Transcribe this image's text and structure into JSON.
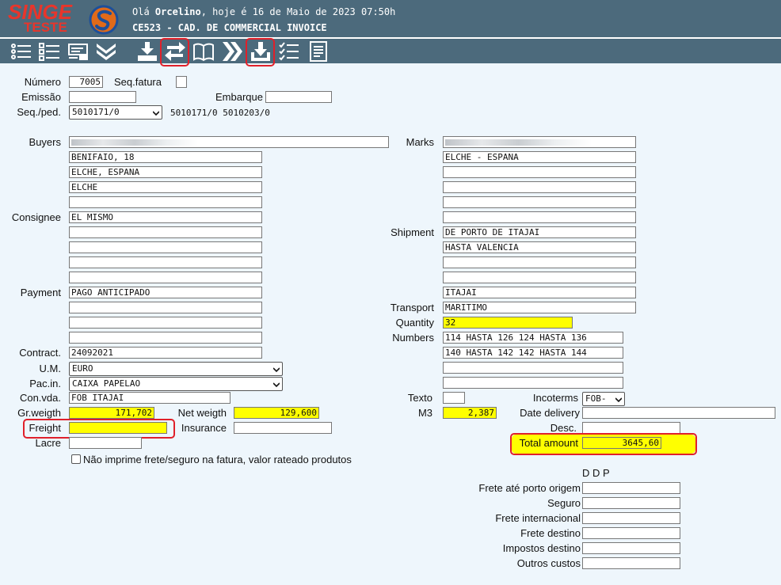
{
  "header": {
    "logo_text": "SINGE",
    "logo_sub": "TESTE",
    "greeting_prefix": "Olá ",
    "user_name": "Orcelino",
    "greeting_suffix": ", hoje é 16 de Maio de 2023 07:50h",
    "screen_title": "CE523 - CAD. DE COMMERCIAL INVOICE"
  },
  "toolbar": {
    "icons": [
      "list-icon",
      "checklist-icon",
      "card-icon",
      "chevron-double-down-icon",
      "download-tray-icon",
      "refresh-arrows-icon",
      "book-icon",
      "chevron-double-right-icon",
      "download-box-icon",
      "checklist-done-icon",
      "document-icon"
    ]
  },
  "form": {
    "numero_label": "Número",
    "numero": "7005",
    "seq_fatura_label": "Seq.fatura",
    "seq_fatura": "",
    "emissao_label": "Emissão",
    "emissao": "",
    "embarque_label": "Embarque",
    "embarque": "",
    "seq_ped_label": "Seq./ped.",
    "seq_ped": "5010171/0",
    "seq_ped_list": "5010171/0 5010203/0",
    "buyers_label": "Buyers",
    "buyers": [
      "",
      "BENIFAIO, 18",
      "ELCHE, ESPANA",
      "ELCHE",
      ""
    ],
    "consignee_label": "Consignee",
    "consignee": [
      "EL MISMO",
      "",
      "",
      "",
      ""
    ],
    "payment_label": "Payment",
    "payment": [
      "PAGO ANTICIPADO",
      "",
      "",
      ""
    ],
    "contract_label": "Contract.",
    "contract": "24092021",
    "um_label": "U.M.",
    "um": "EURO",
    "pacin_label": "Pac.in.",
    "pacin": "CAIXA PAPELAO",
    "convda_label": "Con.vda.",
    "convda": "FOB ITAJAI",
    "grweight_label": "Gr.weigth",
    "grweight": "171,702",
    "netweight_label": "Net weigth",
    "netweight": "129,600",
    "freight_label": "Freight",
    "freight": "",
    "insurance_label": "Insurance",
    "insurance": "",
    "lacre_label": "Lacre",
    "lacre": "",
    "nao_imprime_label": "Não imprime frete/seguro na fatura, valor rateado produtos",
    "marks_label": "Marks",
    "marks": [
      "",
      "ELCHE - ESPANA",
      "",
      "",
      "",
      ""
    ],
    "shipment_label": "Shipment",
    "shipment": [
      "DE PORTO DE ITAJAI",
      "HASTA VALENCIA",
      "",
      "",
      "ITAJAI"
    ],
    "transport_label": "Transport",
    "transport": "MARITIMO",
    "quantity_label": "Quantity",
    "quantity": "32",
    "numbers_label": "Numbers",
    "numbers": [
      " 114 HASTA 126 124 HASTA 136",
      "140 HASTA 142 142 HASTA 144",
      "",
      ""
    ],
    "texto_label": "Texto",
    "texto": "",
    "incoterms_label": "Incoterms",
    "incoterms": "FOB-",
    "m3_label": "M3",
    "m3": "2,387",
    "date_delivery_label": "Date delivery",
    "date_delivery": "",
    "desc_label": "Desc.",
    "desc": "",
    "total_amount_label": "Total amount",
    "total_amount": "3645,60",
    "ddp_title": "D D P",
    "ddp": [
      {
        "label": "Frete até porto origem",
        "value": ""
      },
      {
        "label": "Seguro",
        "value": ""
      },
      {
        "label": "Frete internacional",
        "value": ""
      },
      {
        "label": "Frete destino",
        "value": ""
      },
      {
        "label": "Impostos destino",
        "value": ""
      },
      {
        "label": "Outros custos",
        "value": ""
      }
    ]
  },
  "colors": {
    "header_bg": "#4c6a7c",
    "page_bg": "#eef6fc",
    "highlight": "#ffff00",
    "logo_red": "#e8352b",
    "annotation_red": "#e0202a"
  }
}
